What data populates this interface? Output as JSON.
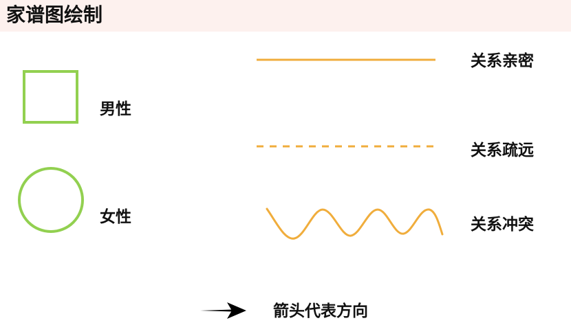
{
  "title": "家谱图绘制",
  "legend": {
    "male": {
      "label": "男性",
      "icon": "square-icon"
    },
    "female": {
      "label": "女性",
      "icon": "circle-icon"
    },
    "close": {
      "label": "关系亲密",
      "icon": "solid-line-icon"
    },
    "distant": {
      "label": "关系疏远",
      "icon": "dashed-line-icon"
    },
    "conflict": {
      "label": "关系冲突",
      "icon": "wavy-line-icon"
    },
    "arrow": {
      "label": "箭头代表方向",
      "icon": "arrow-icon"
    }
  },
  "colors": {
    "title_bar": "#fdf1ee",
    "shape_green": "#92d050",
    "line_orange": "#f0ad3c",
    "text": "#111111",
    "arrow": "#000000"
  }
}
